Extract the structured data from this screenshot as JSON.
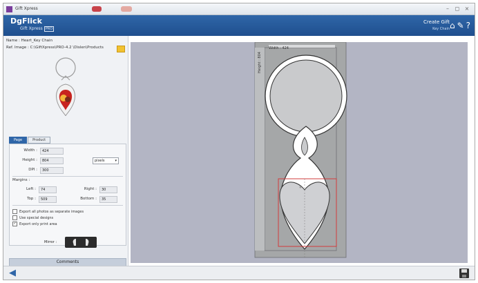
{
  "window": {
    "title": "Gift Xpress",
    "controls": [
      "–",
      "◻",
      "×"
    ]
  },
  "header": {
    "logo_text": "DgFlick",
    "product_name": "Gift Xpress",
    "product_badge": "PRO",
    "create_gift": "Create Gift",
    "item_type": "Key Chain",
    "icons": [
      "home-icon",
      "edit-icon",
      "help-icon"
    ]
  },
  "left": {
    "name_label": "Name :",
    "name_value": "Heart_Key Chain",
    "ref_label": "Ref. Image :",
    "ref_value": "C:\\GiftXpress\\PRO-4.2 \\Dislen\\Products",
    "tabs": [
      "Page",
      "Product"
    ],
    "width_label": "Width :",
    "width_value": "424",
    "height_label": "Height :",
    "height_value": "804",
    "dpi_label": "DPI :",
    "dpi_value": "300",
    "unit_value": "pixels",
    "margins_label": "Margins :",
    "left_label": "Left :",
    "left_value": "74",
    "right_label": "Right :",
    "right_value": "30",
    "top_label": "Top :",
    "top_value": "509",
    "bottom_label": "Bottom :",
    "bottom_value": "35",
    "checkboxes": [
      {
        "label": "Export all photos as separate images",
        "checked": false
      },
      {
        "label": "Use special designs",
        "checked": false
      },
      {
        "label": "Export only print area",
        "checked": true
      }
    ],
    "mirror_label": "Mirror :",
    "comments_label": "Comments"
  },
  "canvas": {
    "width_caption": "Width : 424",
    "height_caption": "Height : 804",
    "background_color": "#b3b5c4",
    "page_color": "#a5a7a8",
    "print_area_color": "#d23b3b"
  }
}
